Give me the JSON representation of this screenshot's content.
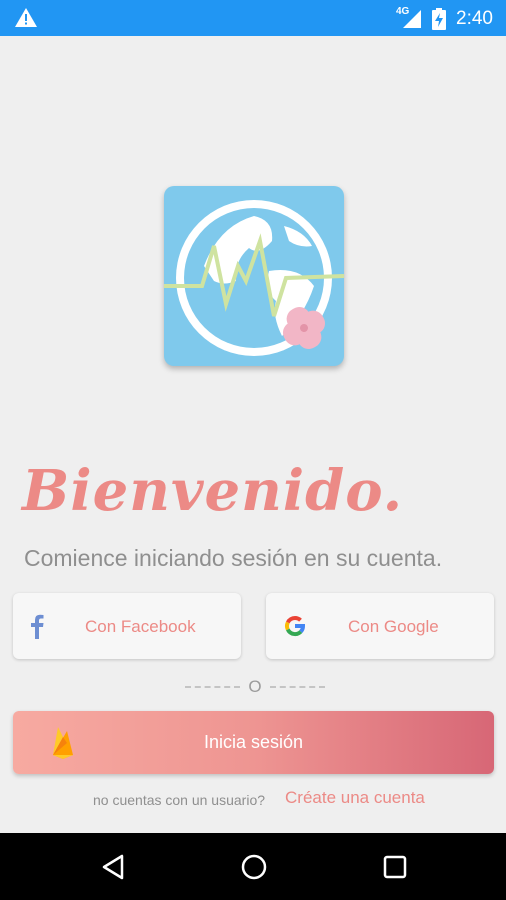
{
  "status_bar": {
    "network": "4G",
    "time": "2:40",
    "icons": [
      "warning-icon",
      "signal-icon",
      "battery-charging-icon"
    ]
  },
  "logo": {
    "icon": "globe-heartbeat-logo"
  },
  "welcome_title": "Bienvenido.",
  "subtitle": "Comience iniciando sesión en su cuenta.",
  "facebook_button": {
    "label": "Con Facebook",
    "icon": "facebook-icon"
  },
  "google_button": {
    "label": "Con Google",
    "icon": "google-icon"
  },
  "separator_text": "O",
  "login_button": {
    "label": "Inicia sesión",
    "icon": "firebase-icon"
  },
  "signup": {
    "question": "no cuentas con un usuario?",
    "link": "Créate una cuenta"
  },
  "nav_bar": {
    "icons": [
      "back-icon",
      "home-icon",
      "recents-icon"
    ]
  },
  "colors": {
    "status_bar": "#2196f3",
    "accent": "#ec8a86",
    "background": "#efefef",
    "button_gradient_start": "#f7aaa1",
    "button_gradient_end": "#d76776"
  }
}
